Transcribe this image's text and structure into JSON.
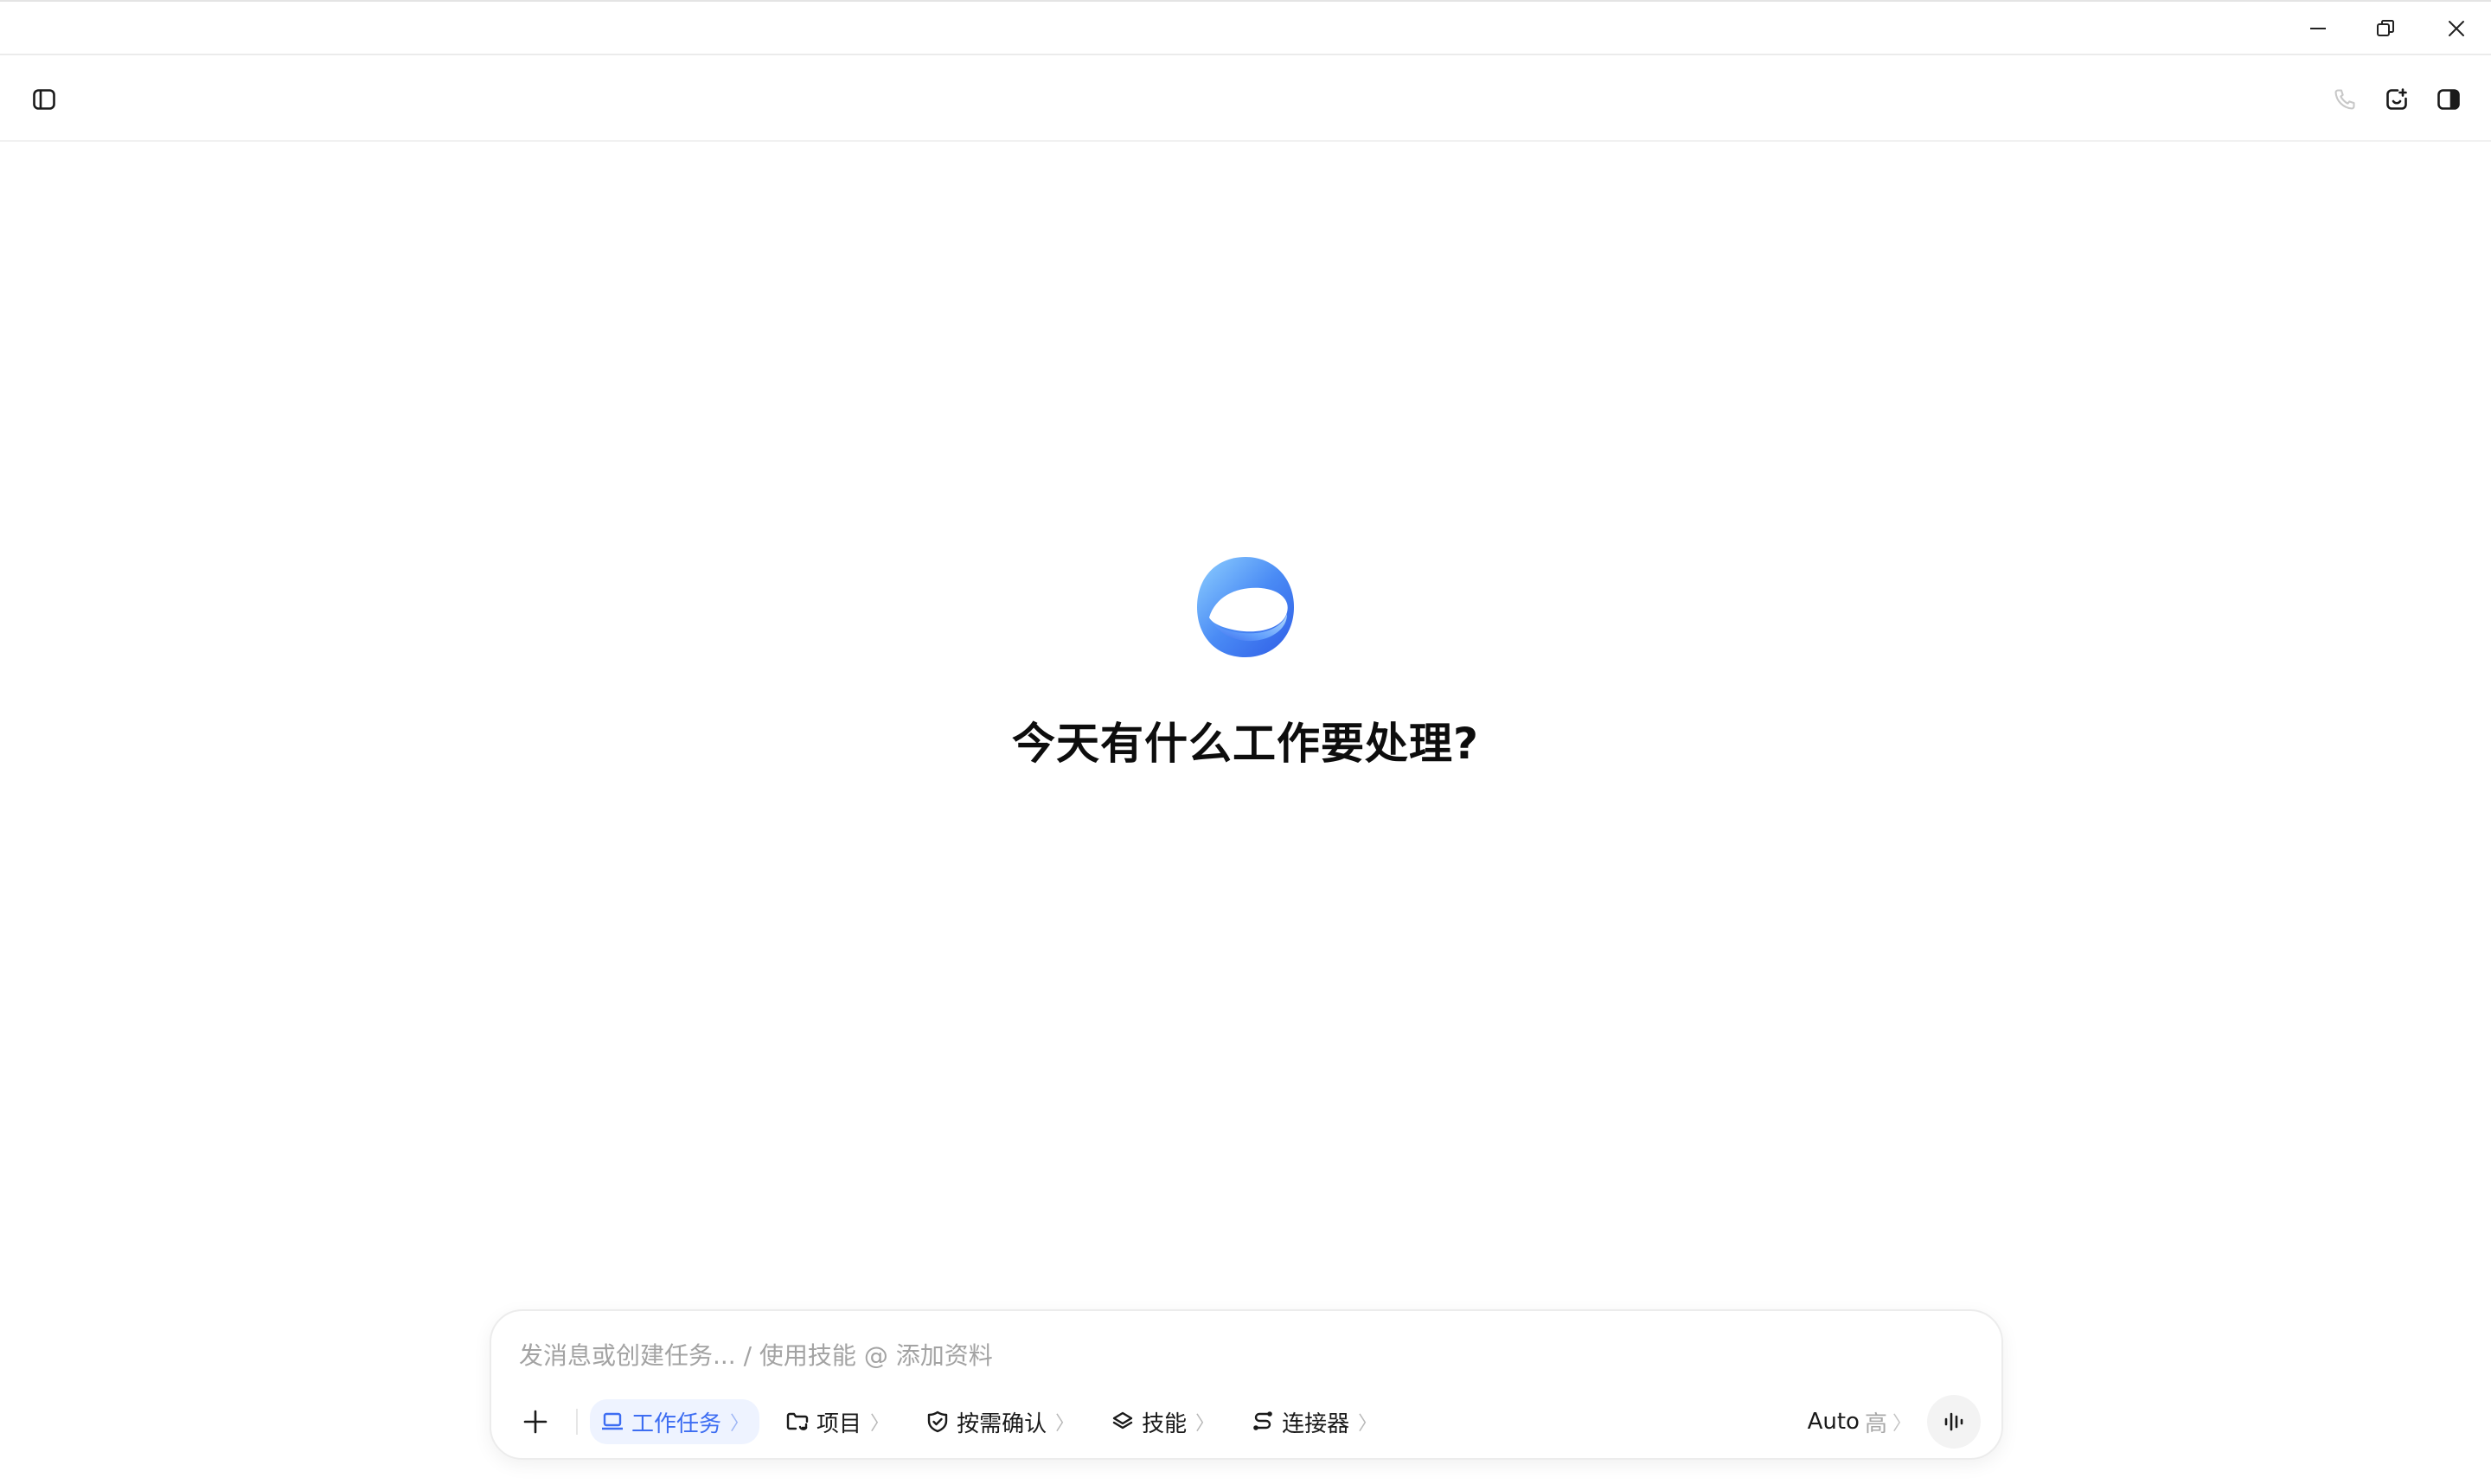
{
  "welcome": {
    "title": "今天有什么工作要处理?"
  },
  "composer": {
    "placeholder": "发消息或创建任务... / 使用技能 @ 添加资料",
    "chips": [
      {
        "label": "工作任务",
        "icon": "laptop-icon",
        "active": true
      },
      {
        "label": "项目",
        "icon": "folder-sync-icon",
        "active": false
      },
      {
        "label": "按需确认",
        "icon": "shield-check-icon",
        "active": false
      },
      {
        "label": "技能",
        "icon": "layers-icon",
        "active": false
      },
      {
        "label": "连接器",
        "icon": "connector-icon",
        "active": false
      }
    ],
    "chevron": "〉",
    "model": {
      "name": "Auto",
      "level": "高"
    }
  },
  "icons": {
    "window": [
      "minimize-icon",
      "restore-icon",
      "close-icon"
    ],
    "toolbar": [
      "sidebar-toggle-icon",
      "phone-icon",
      "new-chat-icon",
      "right-panel-icon"
    ],
    "composer": [
      "plus-icon",
      "voice-wave-icon"
    ]
  },
  "colors": {
    "accent": "#3d6df2",
    "accent_bg": "#eef3ff",
    "placeholder": "#a3a3a3",
    "text": "#111111"
  }
}
